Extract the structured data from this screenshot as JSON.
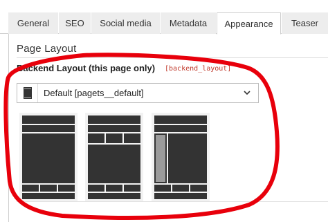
{
  "tabs": [
    {
      "label": "General",
      "active": false
    },
    {
      "label": "SEO",
      "active": false
    },
    {
      "label": "Social media",
      "active": false
    },
    {
      "label": "Metadata",
      "active": false
    },
    {
      "label": "Appearance",
      "active": true
    },
    {
      "label": "Teaser",
      "active": false
    }
  ],
  "section": {
    "title": "Page Layout"
  },
  "field": {
    "label": "Backend Layout (this page only)",
    "key": "[backend_layout]"
  },
  "select": {
    "value": "Default [pagets__default]",
    "icon": "layout-icon"
  },
  "layout_options": [
    {
      "icon": "layout-default-icon"
    },
    {
      "icon": "layout-three-columns-icon"
    },
    {
      "icon": "layout-sidebar-left-icon"
    }
  ],
  "colors": {
    "accent_annotation": "#e8000b",
    "layout_block": "#333333",
    "sidebar_block": "#9b9b9b",
    "key_text": "#c0392b"
  }
}
